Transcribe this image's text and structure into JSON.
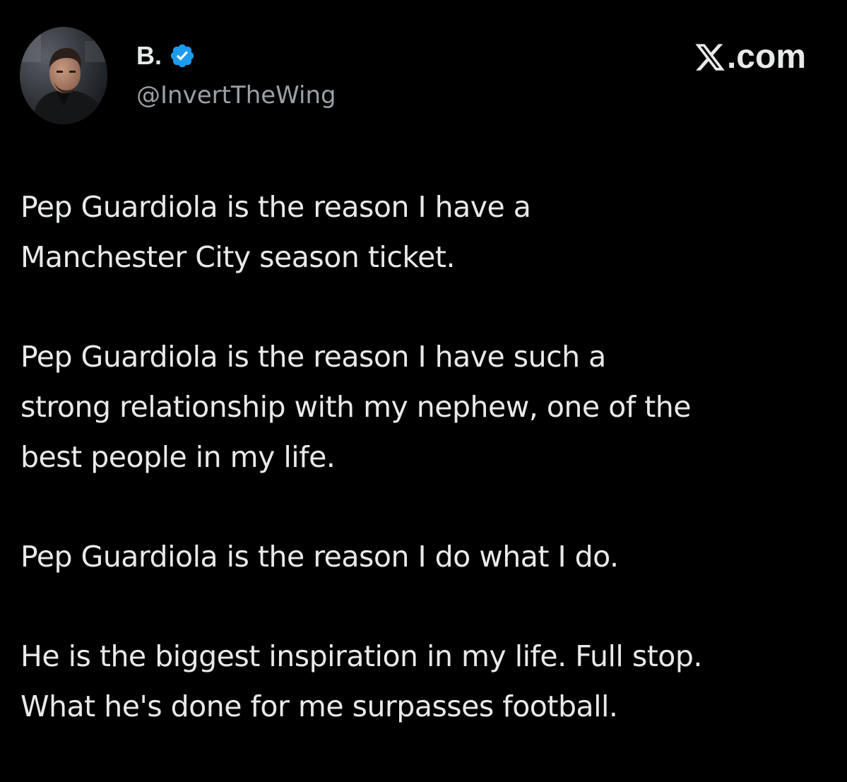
{
  "author": {
    "display_name": "B.",
    "handle": "@InvertTheWing",
    "verified": true,
    "verified_color": "#1d9bf0",
    "avatar_icon": "profile-photo"
  },
  "site": {
    "logo_icon": "x-logo-icon",
    "name": ".com"
  },
  "tweet": {
    "paragraphs": [
      "Pep Guardiola is the reason I have a\nManchester City season ticket.",
      "Pep Guardiola is the reason I have such a\nstrong relationship with my nephew, one of the\nbest people in my life.",
      "Pep Guardiola is the reason I do what I do.",
      "He is the biggest inspiration in my life. Full stop.\nWhat he's done for me surpasses football."
    ]
  },
  "colors": {
    "background": "#000000",
    "text": "#e7e9ea",
    "secondary_text": "#9aa0a6"
  }
}
